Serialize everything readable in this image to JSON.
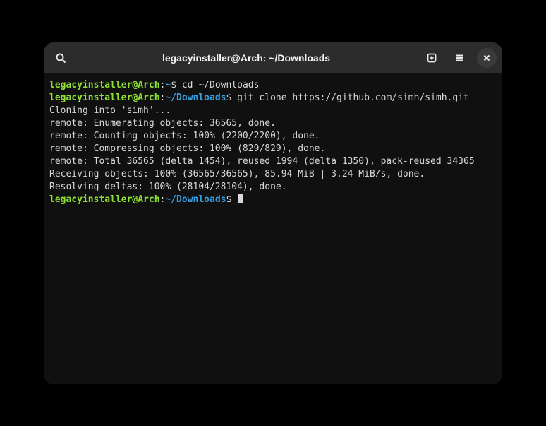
{
  "titlebar": {
    "title": "legacyinstaller@Arch: ~/Downloads"
  },
  "prompt": {
    "user_host": "legacyinstaller@Arch",
    "sep": ":",
    "home_tilde": "~",
    "downloads_path": "~/Downloads",
    "sigil": "$"
  },
  "lines": {
    "cmd1": " cd ~/Downloads",
    "cmd2": " git clone https://github.com/simh/simh.git",
    "out1": "Cloning into 'simh'...",
    "out2": "remote: Enumerating objects: 36565, done.",
    "out3": "remote: Counting objects: 100% (2200/2200), done.",
    "out4": "remote: Compressing objects: 100% (829/829), done.",
    "out5": "remote: Total 36565 (delta 1454), reused 1994 (delta 1350), pack-reused 34365",
    "out6": "Receiving objects: 100% (36565/36565), 85.94 MiB | 3.24 MiB/s, done.",
    "out7": "Resolving deltas: 100% (28104/28104), done."
  }
}
